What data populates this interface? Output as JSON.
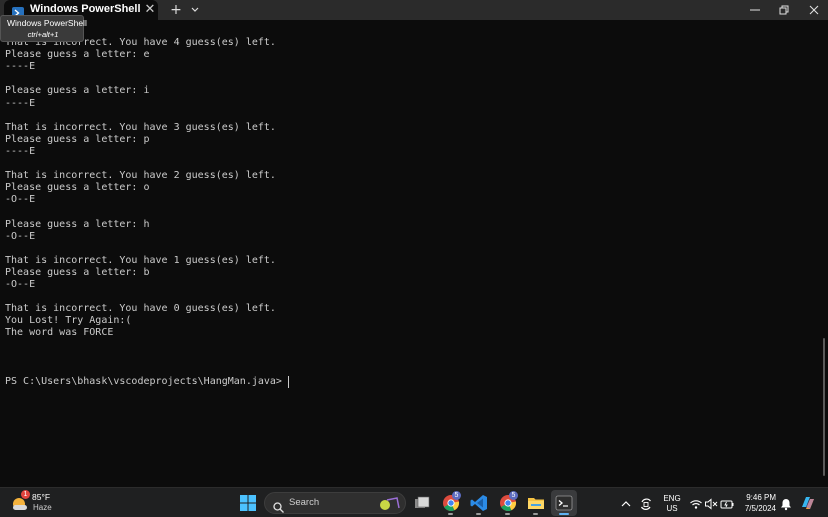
{
  "window": {
    "tab_title": "Windows PowerShell",
    "tooltip_title": "Windows PowerShell",
    "tooltip_shortcut": "ctrl+alt+1",
    "new_tab_label": "+",
    "close_tab_label": "✕"
  },
  "terminal": {
    "lines": [
      "That is incorrect. You have 4 guess(es) left.",
      "Please guess a letter: e",
      "----E",
      "",
      "Please guess a letter: i",
      "----E",
      "",
      "That is incorrect. You have 3 guess(es) left.",
      "Please guess a letter: p",
      "----E",
      "",
      "That is incorrect. You have 2 guess(es) left.",
      "Please guess a letter: o",
      "-O--E",
      "",
      "Please guess a letter: h",
      "-O--E",
      "",
      "That is incorrect. You have 1 guess(es) left.",
      "Please guess a letter: b",
      "-O--E",
      "",
      "That is incorrect. You have 0 guess(es) left.",
      "You Lost! Try Again:(",
      "The word was FORCE",
      "",
      "",
      "",
      "PS C:\\Users\\bhask\\vscodeprojects\\HangMan.java> "
    ]
  },
  "taskbar": {
    "weather_temp": "85°F",
    "weather_condition": "Haze",
    "weather_badge": "1",
    "search_placeholder": "Search",
    "lang_primary": "ENG",
    "lang_secondary": "US",
    "clock_time": "9:46 PM",
    "clock_date": "7/5/2024",
    "app_badge": "5"
  },
  "colors": {
    "terminal_bg": "#0c0c0c",
    "terminal_text": "#cccccc",
    "titlebar_bg": "#2b2b2b",
    "taskbar_bg": "#1f2021",
    "accent": "#5fb2f2"
  },
  "icons": {
    "tab": "powershell-icon",
    "dropdown": "chevron-down-icon",
    "minimize": "minimize-icon",
    "maximize": "restore-icon",
    "close": "close-icon",
    "start": "windows-start-icon",
    "search": "search-icon",
    "apps": [
      "task-view-icon",
      "chrome-icon",
      "vscode-icon",
      "chrome-profile-icon",
      "file-explorer-icon",
      "terminal-icon"
    ],
    "tray": [
      "chevron-up-icon",
      "onedrive-sync-icon",
      "wifi-icon",
      "volume-muted-icon",
      "battery-icon",
      "notification-bell-icon",
      "copilot-icon"
    ]
  }
}
